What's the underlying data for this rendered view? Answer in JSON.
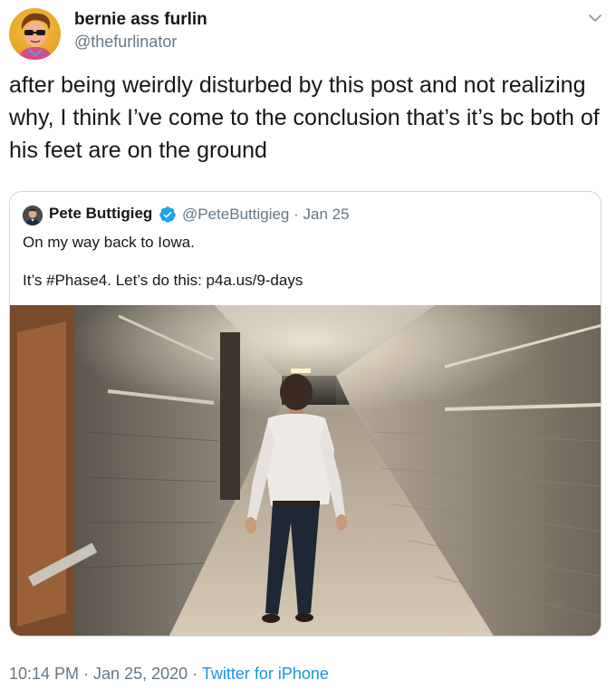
{
  "tweet": {
    "author_name": "bernie ass furlin",
    "author_handle": "@thefurlinator",
    "text": "after being weirdly disturbed by this post and not realizing why, I think I’ve come to the conclusion that’s it’s bc both of his feet are on the ground",
    "timestamp": "10:14 PM · Jan 25, 2020",
    "separator": " · ",
    "source": "Twitter for iPhone",
    "menu_icon": "chevron-down-icon",
    "avatar_icon": "cartoon-avatar"
  },
  "quoted_tweet": {
    "author_name": "Pete Buttigieg",
    "meta": "@PeteButtigieg · Jan 25",
    "verified_icon": "verified-badge-icon",
    "line1": "On my way back to Iowa.",
    "line2": "It’s #Phase4. Let’s do this: p4a.us/9-days",
    "photo": "man-walking-down-hallway-photo"
  },
  "colors": {
    "text_primary": "#14171a",
    "text_secondary": "#657786",
    "link": "#1b95e0",
    "verified": "#1da1f2",
    "border": "#ccd6dd"
  }
}
